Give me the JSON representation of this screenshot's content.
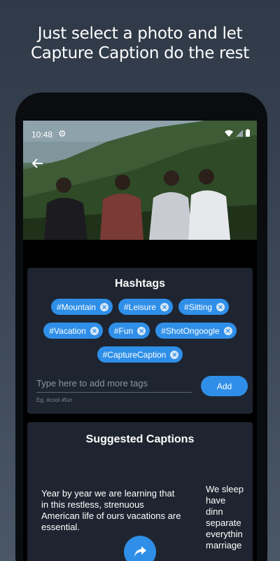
{
  "promo": {
    "line1": "Just select a photo and let",
    "line2": "Capture Caption do the rest"
  },
  "statusbar": {
    "time": "10:48",
    "icons": [
      "gear-icon",
      "wifi-icon",
      "signal-icon",
      "battery-icon"
    ]
  },
  "header": {
    "back_icon": "arrow-left-icon"
  },
  "hashtags": {
    "title": "Hashtags",
    "tags": [
      "#Mountain",
      "#Leisure",
      "#Sitting",
      "#Vacation",
      "#Fun",
      "#ShotOngoogle",
      "#CaptureCaption"
    ],
    "input_placeholder": "Type here to add more tags",
    "input_hint": "Eg. #cool #fun",
    "add_label": "Add"
  },
  "captions": {
    "title": "Suggested Captions",
    "items": [
      "Year by year we are learning that in this restless, strenuous American life of ours vacations are essential.",
      "We sleep have dinn separate everythin marriage"
    ],
    "share_icon": "share-arrow-icon"
  },
  "colors": {
    "accent": "#2f8fe8",
    "card": "#1e2530",
    "background": "#3c4858"
  }
}
